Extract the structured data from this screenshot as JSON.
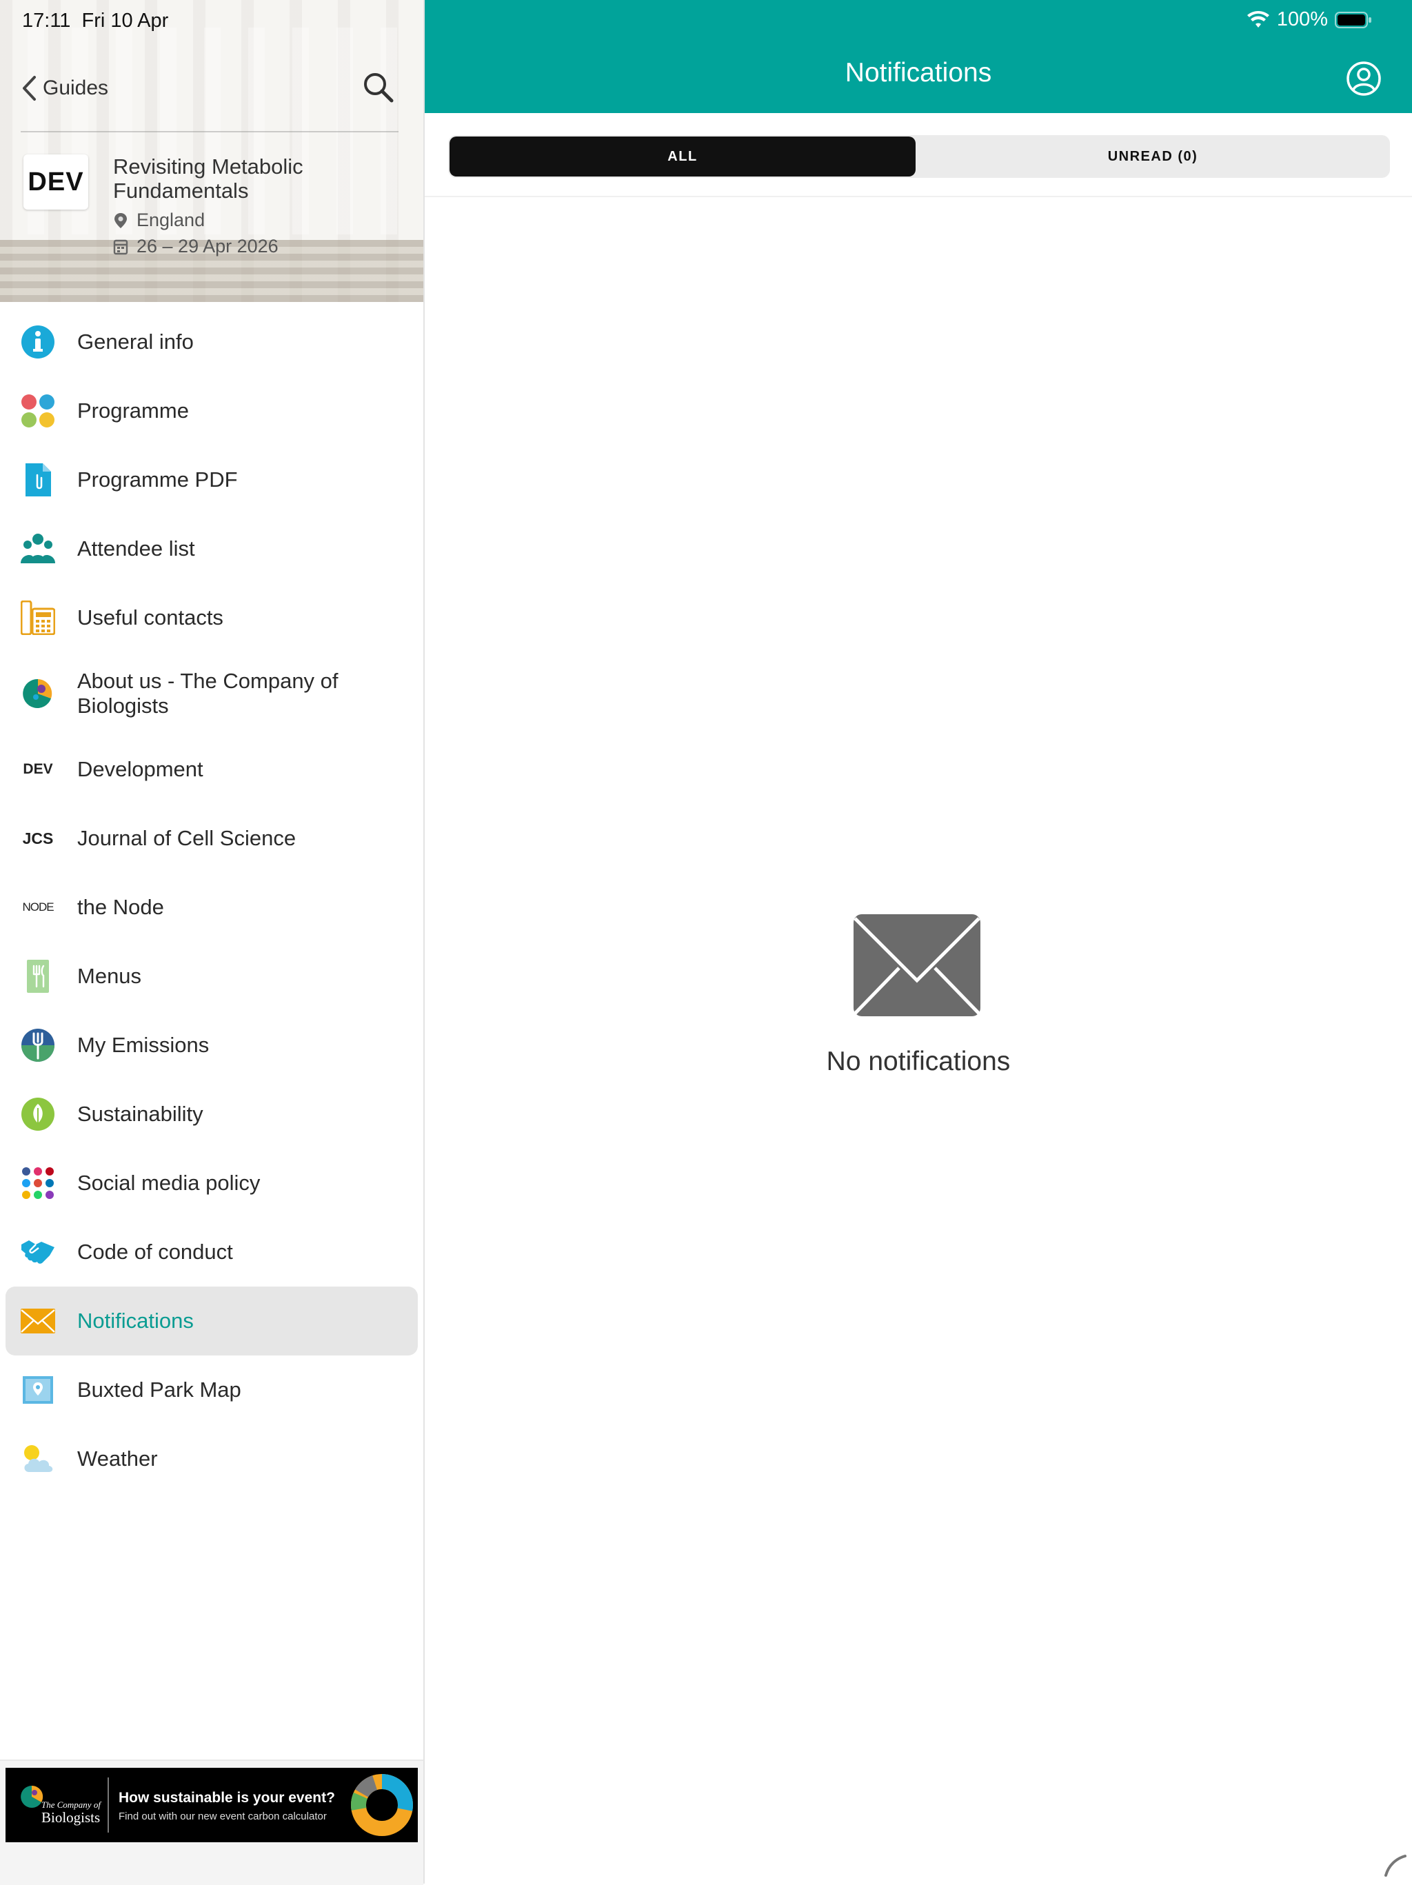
{
  "status_bar": {
    "time": "17:11",
    "date": "Fri 10 Apr",
    "battery": "100%"
  },
  "sidebar": {
    "back_label": "Guides",
    "logo_text": "DEV",
    "event": {
      "title": "Revisiting Metabolic Fundamentals",
      "location": "England",
      "dates": "26 – 29 Apr 2026"
    },
    "items": [
      {
        "label": "General info",
        "icon": "info-icon"
      },
      {
        "label": "Programme",
        "icon": "programme-dots-icon"
      },
      {
        "label": "Programme PDF",
        "icon": "pdf-document-icon"
      },
      {
        "label": "Attendee list",
        "icon": "people-icon"
      },
      {
        "label": "Useful contacts",
        "icon": "phone-icon"
      },
      {
        "label": "About us - The Company of Biologists",
        "icon": "company-logo-icon"
      },
      {
        "label": "Development",
        "icon": "dev-text-icon",
        "icon_text": "DEV"
      },
      {
        "label": "Journal of Cell Science",
        "icon": "jcs-text-icon",
        "icon_text": "JCS"
      },
      {
        "label": "the Node",
        "icon": "node-text-icon",
        "icon_text": "NODE"
      },
      {
        "label": "Menus",
        "icon": "menu-icon"
      },
      {
        "label": "My Emissions",
        "icon": "fork-icon"
      },
      {
        "label": "Sustainability",
        "icon": "leaf-icon"
      },
      {
        "label": "Social media policy",
        "icon": "social-dots-icon"
      },
      {
        "label": "Code of conduct",
        "icon": "handshake-icon"
      },
      {
        "label": "Notifications",
        "icon": "envelope-icon",
        "active": true
      },
      {
        "label": "Buxted Park Map",
        "icon": "map-icon"
      },
      {
        "label": "Weather",
        "icon": "weather-icon"
      }
    ],
    "banner": {
      "logo_line1": "The Company of",
      "logo_line2": "Biologists",
      "headline": "How sustainable is your event?",
      "subline": "Find out with our new event carbon calculator"
    }
  },
  "main": {
    "title": "Notifications",
    "tabs": [
      {
        "label": "ALL",
        "selected": true
      },
      {
        "label": "UNREAD (0)",
        "selected": false
      }
    ],
    "empty_message": "No notifications"
  },
  "colors": {
    "accent": "#01a39a",
    "active_text": "#0a9c92",
    "tab_selected": "#111111",
    "envelope": "#6b6b6b"
  }
}
